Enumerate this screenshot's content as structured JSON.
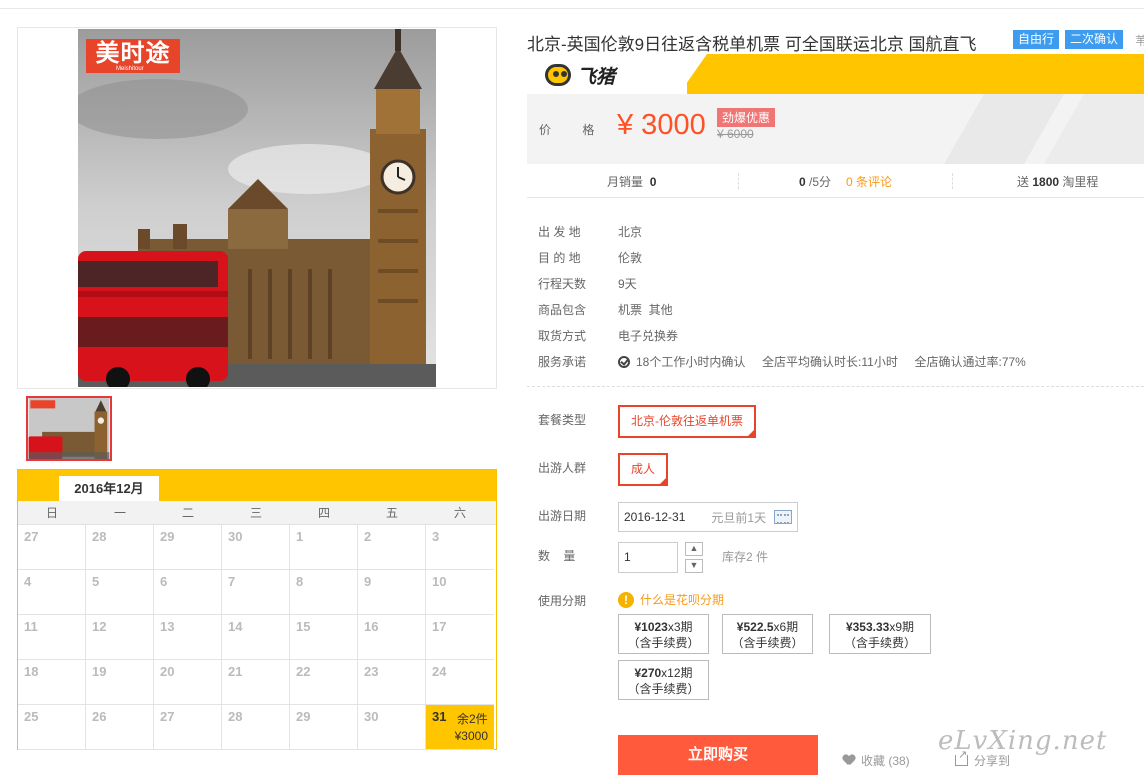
{
  "gallery": {
    "brand_logo": "美时途",
    "brand_logo_sub": "Meishitour",
    "main_image": "london-big-ben-photo",
    "thumbnail": "london-big-ben-thumbnail"
  },
  "calendar": {
    "month": "2016年12月",
    "weekdays": [
      "日",
      "一",
      "二",
      "三",
      "四",
      "五",
      "六"
    ],
    "days": [
      "27",
      "28",
      "29",
      "30",
      "1",
      "2",
      "3",
      "4",
      "5",
      "6",
      "7",
      "8",
      "9",
      "10",
      "11",
      "12",
      "13",
      "14",
      "15",
      "16",
      "17",
      "18",
      "19",
      "20",
      "21",
      "22",
      "23",
      "24",
      "25",
      "26",
      "27",
      "28",
      "29",
      "30",
      "31"
    ],
    "active_day": {
      "day": "31",
      "stock": "余2件",
      "price": "¥3000"
    }
  },
  "product": {
    "title": "北京-英国伦敦9日往返含税单机票 可全国联运北京 国航直飞",
    "tags": [
      "自由行",
      "二次确认"
    ],
    "tag_overflow": "苇",
    "brand": "飞猪",
    "price_label": "价  格",
    "price_now": "¥ 3000",
    "price_badge": "劲爆优惠",
    "price_old": "¥ 6000"
  },
  "stats": {
    "monthly_sales_label": "月销量",
    "monthly_sales": "0",
    "rating": "0",
    "rating_suffix": "/5分",
    "reviews": "0 条评论",
    "mileage_prefix": "送",
    "mileage": "1800",
    "mileage_suffix": "淘里程"
  },
  "info": [
    {
      "k": "出 发 地",
      "v": "北京"
    },
    {
      "k": "目 的 地",
      "v": "伦敦"
    },
    {
      "k": "行程天数",
      "v": "9天"
    },
    {
      "k": "商品包含",
      "v": "机票  其他"
    },
    {
      "k": "取货方式",
      "v": "电子兑换券"
    }
  ],
  "service": {
    "label": "服务承诺",
    "confirm": "18个工作小时内确认",
    "avg": "全店平均确认时长:11小时",
    "rate": "全店确认通过率:77%"
  },
  "options": {
    "package_label": "套餐类型",
    "package_value": "北京-伦敦往返单机票",
    "traveler_label": "出游人群",
    "traveler_value": "成人",
    "date_label": "出游日期",
    "date_value": "2016-12-31",
    "date_hint": "元旦前1天",
    "qty_label": "数    量",
    "qty_value": "1",
    "stock_text": "库存2 件",
    "installment_label": "使用分期",
    "huabei_link": "什么是花呗分期",
    "installments": [
      {
        "amount": "¥1023",
        "term": "x3期",
        "fee": "（含手续费）"
      },
      {
        "amount": "¥522.5",
        "term": "x6期",
        "fee": "（含手续费）"
      },
      {
        "amount": "¥353.33",
        "term": "x9期",
        "fee": "（含手续费）"
      },
      {
        "amount": "¥270",
        "term": "x12期",
        "fee": "（含手续费）"
      }
    ]
  },
  "actions": {
    "buy": "立即购买",
    "favorite": "收藏 (38)",
    "share": "分享到"
  },
  "watermark": "eLvXing.net",
  "colors": {
    "accent": "#ff5026",
    "yellow": "#ffc600",
    "blue_tag": "#3d9cf0"
  }
}
